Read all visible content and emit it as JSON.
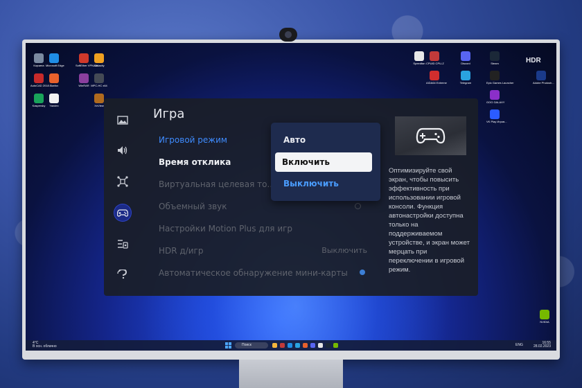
{
  "menu": {
    "title": "Игра",
    "items": [
      {
        "label": "Игровой режим"
      },
      {
        "label": "Время отклика"
      },
      {
        "label": "Виртуальная целевая то..."
      },
      {
        "label": "Объемный звук"
      },
      {
        "label": "Настройки Motion Plus для игр"
      },
      {
        "label": "HDR д/игр",
        "value": "Выключить"
      },
      {
        "label": "Автоматическое обнаружение мини-карты"
      }
    ],
    "dropdown_options": [
      "Авто",
      "Включить",
      "Выключить"
    ],
    "description": "Оптимизируйте свой экран, чтобы повысить эффективность при использовании игровой консоли. Функция автонастройки доступна только на поддерживаемом устройстве, и экран может мерцать при переключении в игровой режим."
  },
  "sidebar_icons": [
    "picture-icon",
    "sound-icon",
    "connection-icon",
    "gamepad-icon",
    "general-settings-icon",
    "support-icon"
  ],
  "desktop_icons_left": [
    {
      "label": "Корзина",
      "color": "#7a8aa0"
    },
    {
      "label": "Microsoft Edge",
      "color": "#1f8de6"
    },
    {
      "label": "SoftEther VPN Cli...",
      "color": "#d0392b"
    },
    {
      "label": "Audacity",
      "color": "#f0a020"
    },
    {
      "label": "AutoCAD 2018 —...",
      "color": "#c72a2a"
    },
    {
      "label": "Firefox",
      "color": "#e8612c"
    },
    {
      "label": "WinRAR",
      "color": "#8a3f9e"
    },
    {
      "label": "MPC-HC x64",
      "color": "#444a55"
    },
    {
      "label": "Kaspersky",
      "color": "#19a35a"
    },
    {
      "label": "Yandex",
      "color": "#f2f2f2"
    },
    {
      "label": "XnView",
      "color": "#b06a1e"
    }
  ],
  "desktop_icons_right": [
    {
      "label": "Speedfan",
      "color": "#e8e8e8"
    },
    {
      "label": "CPUID CPU-Z",
      "color": "#c23a3a"
    },
    {
      "label": "Discord",
      "color": "#5865f2"
    },
    {
      "label": "Steam",
      "color": "#1b2838"
    },
    {
      "label": "AIDA64 Extreme",
      "color": "#d12e2e"
    },
    {
      "label": "Telegram",
      "color": "#2aa3e0"
    },
    {
      "label": "Epic Games Launcher",
      "color": "#222"
    },
    {
      "label": "Adobe Photosh...",
      "color": "#1a3a8a"
    },
    {
      "label": "GOG GALAXY",
      "color": "#8b2fc9"
    },
    {
      "label": "VK Play Игров...",
      "color": "#2b5cff"
    },
    {
      "label": "NVIDIA",
      "color": "#76b900"
    }
  ],
  "monitor_badge": "HDR",
  "taskbar": {
    "weather_temp": "4°C",
    "weather_text": "В осн. облачно",
    "search": "Поиск",
    "lang": "ENG",
    "time": "16:55",
    "date": "28.02.2023"
  }
}
